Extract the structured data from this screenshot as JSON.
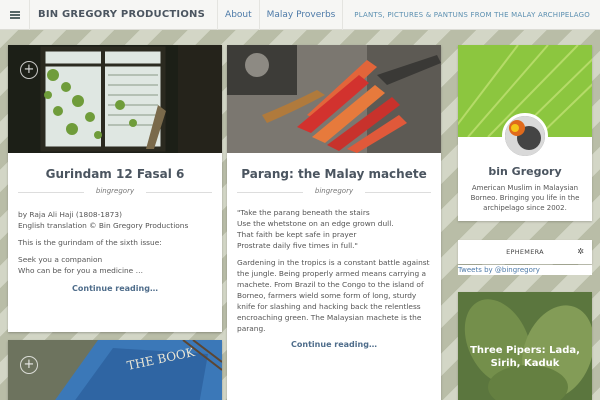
{
  "header": {
    "site_title": "BIN GREGORY PRODUCTIONS",
    "nav": [
      "About",
      "Malay Proverbs"
    ],
    "tagline": "PLANTS, PICTURES & PANTUNS FROM THE MALAY ARCHIPELAGO"
  },
  "posts": [
    {
      "title": "Gurindam 12 Fasal 6",
      "author": "bingregory",
      "lines": [
        "by Raja Ali Haji (1808-1873)",
        "English translation © Bin Gregory Productions"
      ],
      "para1": "This is the gurindam of the sixth issue:",
      "verse": [
        "Seek you a companion",
        "Who can be for you a medicine …"
      ],
      "more": "Continue reading…"
    },
    {
      "title": "Parang: the Malay machete",
      "author": "bingregory",
      "verse": [
        "\"Take the parang beneath the stairs",
        "Use the whetstone on an edge grown dull.",
        "That faith be kept safe in prayer",
        "Prostrate daily five times in full.\""
      ],
      "body": "Gardening in the tropics is a constant battle against the jungle. Being properly armed means carrying a machete. From Brazil to the Congo to the island of Borneo, farmers wield some form of long, sturdy knife for slashing and hacking back the relentless encroaching green. The Malaysian machete is the parang.",
      "more": "Continue reading…"
    }
  ],
  "profile": {
    "name": "bin Gregory",
    "bio": "American Muslim in Malaysian Borneo. Bringing you life in the archipelago since 2002."
  },
  "ephemera": {
    "label": "EPHEMERA",
    "tweets_link": "Tweets by @bingregory"
  },
  "feature": {
    "title": "Three Pipers: Lada, Sirih, Kaduk"
  },
  "colors": {
    "link": "#4d7aa8",
    "title": "#4b5560"
  }
}
